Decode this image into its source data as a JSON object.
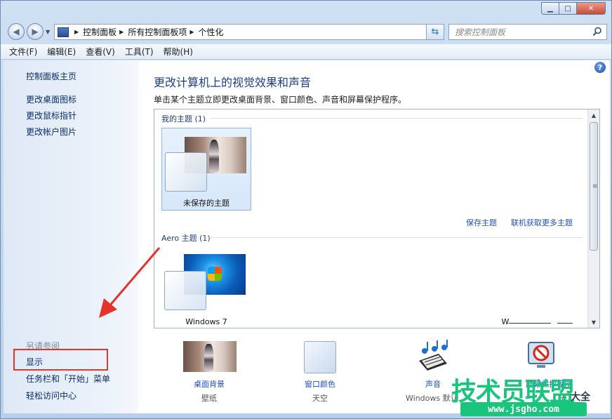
{
  "window": {
    "controls": {
      "minimize": "▁",
      "maximize": "□",
      "close": "✕"
    }
  },
  "address_bar": {
    "crumbs": [
      "控制面板",
      "所有控制面板项",
      "个性化"
    ],
    "search_placeholder": "搜索控制面板"
  },
  "menu": [
    "文件(F)",
    "编辑(E)",
    "查看(V)",
    "工具(T)",
    "帮助(H)"
  ],
  "left_pane": {
    "home": "控制面板主页",
    "links": [
      "更改桌面图标",
      "更改鼠标指针",
      "更改帐户图片"
    ],
    "see_also_title": "另请参阅",
    "see_also": [
      "显示",
      "任务栏和「开始」菜单",
      "轻松访问中心"
    ]
  },
  "main": {
    "title": "更改计算机上的视觉效果和声音",
    "subtitle": "单击某个主题立即更改桌面背景、窗口颜色、声音和屏幕保护程序。",
    "my_themes": {
      "label": "我的主题 (1)",
      "items": [
        {
          "name": "未保存的主题"
        }
      ]
    },
    "save_theme": "保存主题",
    "get_more": "联机获取更多主题",
    "aero_themes": {
      "label": "Aero 主题 (1)",
      "items": [
        {
          "name": "Windows 7"
        }
      ],
      "partial_label": "W"
    }
  },
  "bottom": [
    {
      "link": "桌面背景",
      "value": "壁纸"
    },
    {
      "link": "窗口颜色",
      "value": "天空"
    },
    {
      "link": "声音",
      "value": "Windows 默认"
    },
    {
      "link": "屏幕保护程序",
      "value": "无"
    }
  ],
  "watermark": {
    "main": "技术员联盟",
    "sub": "大全",
    "url": "www.jsgho.com"
  }
}
